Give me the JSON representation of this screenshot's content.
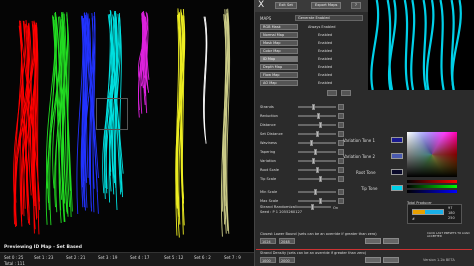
{
  "viewport": {
    "preview_label": "Previewing ID Map - Set Based",
    "total": "Total : 111",
    "sets": [
      {
        "label": "Set 0 : 25",
        "color": "#ff0000"
      },
      {
        "label": "Set 1 : 23",
        "color": "#22dd22"
      },
      {
        "label": "Set 2 : 21",
        "color": "#2233ff"
      },
      {
        "label": "Set 3 : 19",
        "color": "#00e0e0"
      },
      {
        "label": "Set 4 : 17",
        "color": "#dd22dd"
      },
      {
        "label": "Set 5 : 12",
        "color": "#eeee22"
      },
      {
        "label": "Set 6 : 2",
        "color": "#ffffff"
      },
      {
        "label": "Set 7 : 9",
        "color": "#cccc88"
      }
    ]
  },
  "panel": {
    "menu": {
      "close": "X",
      "exit": "Exit Set",
      "export": "Export Maps",
      "q": "?"
    },
    "maps_label": "MAPS",
    "generate_label": "Generate Enabled",
    "maps": [
      {
        "name": "RGB Mask",
        "state": "Always Enabled"
      },
      {
        "name": "Normal Map",
        "state": "Enabled"
      },
      {
        "name": "Mask Map",
        "state": "Enabled"
      },
      {
        "name": "Color Map",
        "state": "Enabled"
      },
      {
        "name": "ID Map",
        "state": "Enabled"
      },
      {
        "name": "Depth Map",
        "state": "Enabled"
      },
      {
        "name": "Flow Map",
        "state": "Enabled"
      },
      {
        "name": "AO Map",
        "state": "Enabled"
      }
    ],
    "params": [
      {
        "label": "Strands",
        "knob": 0.4
      },
      {
        "label": "Reduction",
        "knob": 0.55
      },
      {
        "label": "Distance",
        "knob": 0.6
      },
      {
        "label": "Set Distance",
        "knob": 0.5
      },
      {
        "label": "Waviness",
        "knob": 0.35
      },
      {
        "label": "Tapering",
        "knob": 0.45
      },
      {
        "label": "Variation",
        "knob": 0.4
      },
      {
        "label": "Root Scale",
        "knob": 0.5
      },
      {
        "label": "Tip Scale",
        "knob": 0.6
      },
      {
        "label": "Min Scale",
        "knob": 0.45
      },
      {
        "label": "Max Scale",
        "knob": 0.6
      }
    ],
    "tones": [
      {
        "label": "Variation Tone 1",
        "color": "#1a1a90"
      },
      {
        "label": "Variation Tone 2",
        "color": "#4a5ab0"
      },
      {
        "label": "Root Tone",
        "color": "#0a0a2a"
      },
      {
        "label": "Tip Tone",
        "color": "#00d0e8"
      }
    ],
    "strand_randomization": "Strand Randomization",
    "seed": "Seed : P 1  2055260127",
    "on_label": "On",
    "total_producer": "Total Producer",
    "readout_values": [
      "97",
      "180",
      "250"
    ],
    "readout_hash": "#",
    "bottom_line1": "Closest Lower Bound (sets can be an override if greater than zero)",
    "bottom_line2": "Strand Density (sets can be an override if greater than zero)",
    "bottom_fields": [
      "1024",
      "2048",
      "1000",
      "2000"
    ],
    "version": "Version 1.2b BETA",
    "hint": "CLICK LAST PRESETS TO LOAD ACCEPTED"
  }
}
